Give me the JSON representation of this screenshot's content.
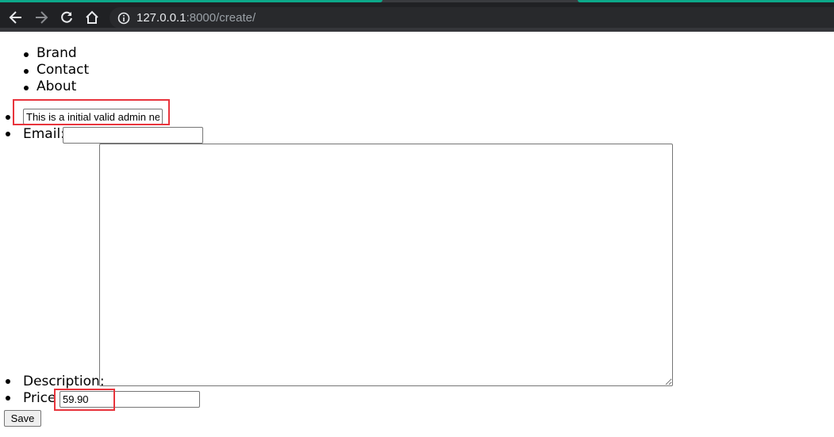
{
  "browser": {
    "url_host": "127.0.0.1",
    "url_path": ":8000/create/",
    "tab_accent_color": "#0ca88a",
    "icons": {
      "back": "arrow-left-icon",
      "forward": "arrow-right-icon",
      "reload": "reload-icon",
      "home": "home-icon",
      "info": "info-icon"
    }
  },
  "nav": {
    "items": [
      "Brand",
      "Contact",
      "About"
    ]
  },
  "form": {
    "title_input_value": "This is a initial valid admin ne",
    "email_label": "Email:",
    "email_value": "",
    "description_label": "Description:",
    "description_value": "",
    "price_label": "Price",
    "price_value": "59.90",
    "save_label": "Save"
  },
  "annotations": {
    "highlight_color": "#e8343c"
  }
}
